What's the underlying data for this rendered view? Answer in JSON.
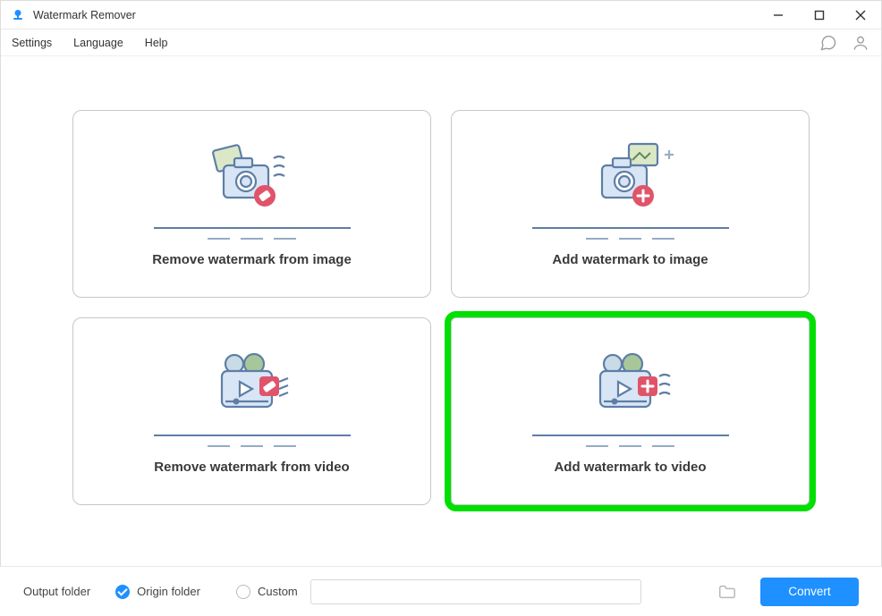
{
  "window": {
    "title": "Watermark Remover"
  },
  "menu": {
    "settings": "Settings",
    "language": "Language",
    "help": "Help"
  },
  "cards": {
    "remove_image": "Remove watermark from image",
    "add_image": "Add watermark to image",
    "remove_video": "Remove watermark from video",
    "add_video": "Add watermark to video"
  },
  "footer": {
    "output_label": "Output folder",
    "origin_label": "Origin folder",
    "custom_label": "Custom",
    "path_value": "",
    "convert_label": "Convert"
  },
  "colors": {
    "accent": "#1e90ff",
    "highlight": "#00e000",
    "stroke": "#5e7ea6",
    "badge": "#e0546a",
    "film": "#90b9c4"
  }
}
